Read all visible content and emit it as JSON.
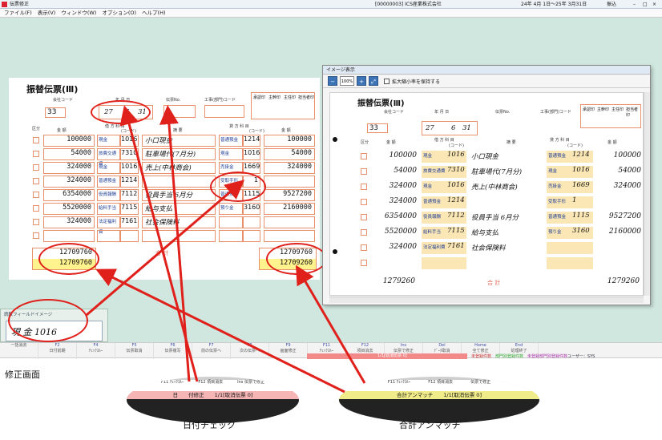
{
  "window": {
    "title": "伝票修正",
    "company": "[00000003] ICS産業株式会社",
    "period": "24年 4月 1日〜25年 3月31日",
    "mode": "振込"
  },
  "menu": [
    "ファイル(F)",
    "表示(V)",
    "ウィンドウ(W)",
    "オプション(O)",
    "ヘルプ(H)"
  ],
  "slip": {
    "title": "振替伝票(Ⅲ)",
    "labels": {
      "company_code": "会社コード",
      "date": "年 月 日",
      "slip_no": "伝票No.",
      "project_code": "工事(部門)コード",
      "approve": "承認印",
      "supervisor": "主幹印",
      "section": "主任印",
      "staff": "担当者印",
      "col_kubun": "区分",
      "col_amount": "金 額",
      "col_debit": "借 方 科 目",
      "col_code": "(コード)",
      "col_memo": "摘 要",
      "col_credit": "貸 方 科 目",
      "total_label": "合 計"
    },
    "company_code": "33",
    "date_y": "27",
    "date_m": "6",
    "date_d": "31",
    "rows": [
      {
        "debit_amt": "100000",
        "debit_acc": "現金",
        "debit_code": "1016",
        "memo": "小口現金",
        "credit_acc": "普通預金",
        "credit_code": "1214",
        "credit_amt": "100000"
      },
      {
        "debit_amt": "54000",
        "debit_acc": "旅費交通費",
        "debit_code": "7310",
        "memo": "駐車場代(7月分)",
        "credit_acc": "現金",
        "credit_code": "1016",
        "credit_amt": "54000"
      },
      {
        "debit_amt": "324000",
        "debit_acc": "現金",
        "debit_code": "1016",
        "memo": "売上(中林商会)",
        "credit_acc": "売掛金",
        "credit_code": "1669",
        "credit_amt": "324000"
      },
      {
        "debit_amt": "324000",
        "debit_acc": "普通預金",
        "debit_code": "1214",
        "memo": "",
        "credit_acc": "受取手形",
        "credit_code": "1",
        "credit_amt": ""
      },
      {
        "debit_amt": "6354000",
        "debit_acc": "役員報酬",
        "debit_code": "7112",
        "memo": "役員手当 6月分",
        "credit_acc": "普通預金",
        "credit_code": "1115",
        "credit_amt": "9527200"
      },
      {
        "debit_amt": "5520000",
        "debit_acc": "給料手当",
        "debit_code": "7115",
        "memo": "給与支払",
        "credit_acc": "預り金",
        "credit_code": "3160",
        "credit_amt": "2160000"
      },
      {
        "debit_amt": "324000",
        "debit_acc": "法定福利費",
        "debit_code": "7161",
        "memo": "社会保険料",
        "credit_acc": "",
        "credit_code": "",
        "credit_amt": ""
      },
      {
        "debit_amt": "",
        "debit_acc": "",
        "debit_code": "",
        "memo": "",
        "credit_acc": "",
        "credit_code": "",
        "credit_amt": ""
      }
    ],
    "total_left_1": "12709760",
    "total_left_2": "12709760",
    "total_right_1": "12709760",
    "total_right_2": "12709260",
    "overlay_code": "1016"
  },
  "popup": {
    "title": "イメージ表示",
    "tool_100": "100%",
    "keep_ratio": "拡大縮小率を保持する",
    "paper_total": "1279260",
    "paper_total_right": "1279260"
  },
  "image_panel": {
    "title": "読取フィールドイメージ",
    "content": "現 金 1016"
  },
  "fkeys": [
    {
      "n": "",
      "l": "一括消去"
    },
    {
      "n": "F2",
      "l": "日付前期"
    },
    {
      "n": "F4",
      "l": "ﾁｪｯｸｽﾙｰ"
    },
    {
      "n": "F5",
      "l": "伝票取消"
    },
    {
      "n": "F6",
      "l": "伝票複写"
    },
    {
      "n": "F7",
      "l": "前の伝票へ"
    },
    {
      "n": "F8",
      "l": "次の伝票へ"
    },
    {
      "n": "F9",
      "l": "画面修正"
    },
    {
      "n": "F11",
      "l": "ﾁｪｯｸｽﾙｰ"
    },
    {
      "n": "F12",
      "l": "項目消去"
    },
    {
      "n": "Ins",
      "l": "伝票で修正"
    },
    {
      "n": "Del",
      "l": "ﾃﾞｰﾀ取消"
    },
    {
      "n": "Home",
      "l": "全て修正"
    },
    {
      "n": "End",
      "l": "処理終了"
    }
  ],
  "status": {
    "msg": "1/1[取消伝票 0]",
    "flag1": "未登録件数",
    "flag2": "部門別登録件数",
    "flag3": "未登録部門別登録件数",
    "user": "ユーザー：SYS"
  },
  "caption": "修正画面",
  "callout_left": {
    "keys": [
      "F11 ﾁｪｯｸｽﾙｰ",
      "F12 項目消去",
      "Ins 伝票で修正"
    ],
    "bar": "日　　付修正　　1/1[取消伝票 0]",
    "label": "日付チェック"
  },
  "callout_right": {
    "keys": [
      "F11 ﾁｪｯｸｽﾙｰ",
      "F12 項目消去",
      "伝票で修正"
    ],
    "bar": "合計アンマッチ　　1/1[取消伝票 0]",
    "label": "合計アンマッチ"
  },
  "colors": {
    "accent": "#e0201b",
    "desk": "#cfe7de",
    "grid": "#e7906b"
  }
}
